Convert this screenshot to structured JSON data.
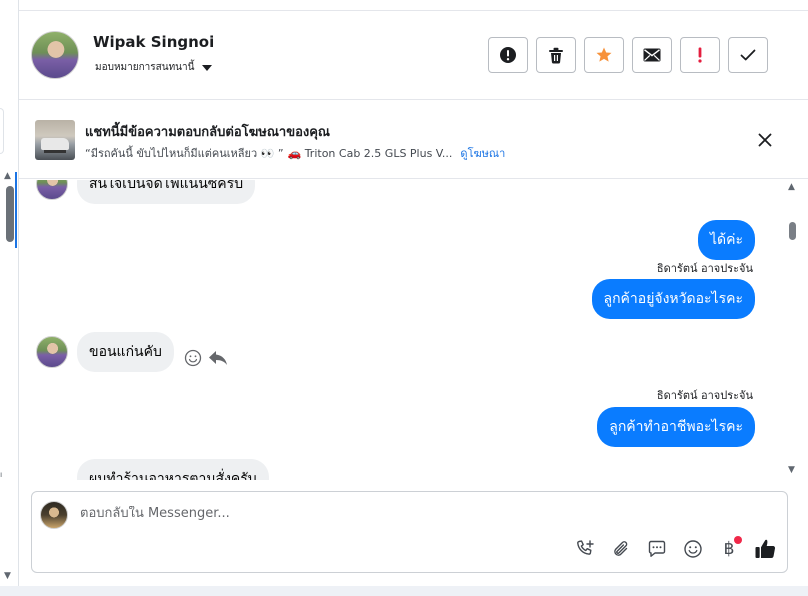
{
  "header": {
    "contact_name": "Wipak Singnoi",
    "assign_label": "มอบหมายการสนทนานี้",
    "actions": [
      {
        "name": "spam",
        "icon": "alert-circle-icon"
      },
      {
        "name": "delete",
        "icon": "trash-icon"
      },
      {
        "name": "star",
        "icon": "star-icon",
        "color": "#f7923b"
      },
      {
        "name": "mark-unread",
        "icon": "envelope-icon"
      },
      {
        "name": "follow-up",
        "icon": "exclamation-icon",
        "color": "#e41e3f"
      },
      {
        "name": "done",
        "icon": "check-icon"
      }
    ]
  },
  "ad_banner": {
    "title": "แชทนี้มีข้อความตอบกลับต่อโฆษณาของคุณ",
    "quote": "“มีรถคันนี้ ขับไปไหนก็มีแต่คนเหลียว 👀 ”",
    "product": "🚗 Triton Cab 2.5 GLS Plus V...",
    "link": "ดูโฆษณา"
  },
  "messages": [
    {
      "direction": "in",
      "text": "สนใจเป็นจัดไฟแนนซ์ครับ"
    },
    {
      "direction": "out",
      "text": "ได้ค่ะ"
    },
    {
      "direction": "out",
      "sender": "ธิดารัตน์ อาจประจัน",
      "text": "ลูกค้าอยู่จังหวัดอะไรคะ"
    },
    {
      "direction": "in",
      "text": "ขอนแก่นคับ"
    },
    {
      "direction": "out",
      "sender": "ธิดารัตน์ อาจประจัน",
      "text": "ลูกค้าทำอาชีพอะไรคะ"
    },
    {
      "direction": "in",
      "text": "ผมทำร้านอาหารตามสั่งครับ"
    }
  ],
  "composer": {
    "placeholder": "ตอบกลับใน Messenger...",
    "tools": [
      "phone-plus-icon",
      "paperclip-icon",
      "saved-reply-icon",
      "emoji-icon",
      "baht-icon",
      "thumbs-up-icon"
    ],
    "baht_symbol": "฿"
  },
  "colors": {
    "outgoing_bubble": "#0a7cff",
    "incoming_bubble": "#eef0f2",
    "link": "#1b74e4"
  }
}
